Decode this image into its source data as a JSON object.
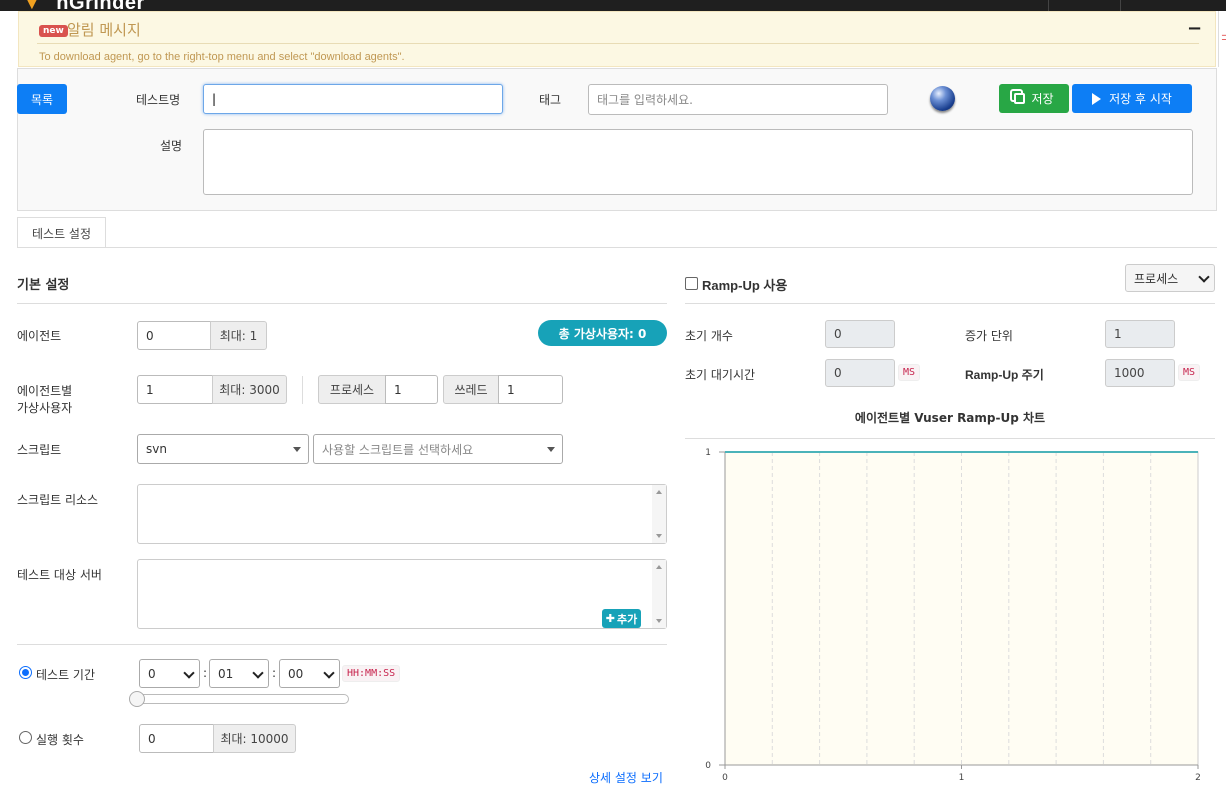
{
  "topbar": {
    "logo_text": "nGrinder"
  },
  "alert": {
    "badge": "new",
    "title": "알림 메시지",
    "message": "To download agent, go to the right-top menu and select \"download agents\".",
    "collapse": "−"
  },
  "header": {
    "list_button": "목록",
    "test_name_label": "테스트명",
    "test_name_value": "",
    "tag_label": "태그",
    "tag_placeholder": "태그를 입력하세요.",
    "save_button": "저장",
    "save_run_button": "저장 후 시작",
    "desc_label": "설명",
    "desc_value": ""
  },
  "tabs": [
    {
      "label": "테스트 설정"
    }
  ],
  "basic": {
    "title": "기본 설정",
    "agent_label": "에이전트",
    "agent_value": "0",
    "agent_max": "최대: 1",
    "total_vuser": "총 가상사용자: 0",
    "vuser_label_1": "에이전트별",
    "vuser_label_2": "가상사용자",
    "vuser_value": "1",
    "vuser_max": "최대: 3000",
    "process_label": "프로세스",
    "process_value": "1",
    "thread_label": "쓰레드",
    "thread_value": "1",
    "script_label": "스크립트",
    "script_repo": "svn",
    "script_placeholder": "사용할 스크립트를 선택하세요",
    "resource_label": "스크립트 리소스",
    "target_label": "테스트 대상 서버",
    "add_button": "추가",
    "duration_label": "테스트 기간",
    "duration_hh": "0",
    "duration_mm": "01",
    "duration_ss": "00",
    "duration_format": "HH:MM:SS",
    "duration_slider": 0,
    "runcount_label": "실행 횟수",
    "runcount_value": "0",
    "runcount_max": "최대: 10000",
    "advanced_link": "상세 설정 보기"
  },
  "rampup": {
    "checkbox_label": "Ramp-Up 사용",
    "checked": false,
    "type_select": "프로세스",
    "init_count_label": "초기 개수",
    "init_count_value": "0",
    "step_label": "증가 단위",
    "step_value": "1",
    "init_wait_label": "초기 대기시간",
    "init_wait_value": "0",
    "ms": "MS",
    "period_label": "Ramp-Up 주기",
    "period_value": "1000"
  },
  "chart_data": {
    "type": "line",
    "title": "에이전트별 Vuser Ramp-Up 차트",
    "x": [
      0,
      2
    ],
    "series": [
      {
        "values": [
          1,
          1
        ],
        "color": "#4bb3b9"
      }
    ],
    "xticks": [
      "0",
      "1",
      "2"
    ],
    "yticks": [
      "0",
      "1"
    ],
    "xlim": [
      0,
      2
    ],
    "ylim": [
      0,
      1
    ],
    "grid": "vertical dashed",
    "background": "#fffdf3"
  }
}
